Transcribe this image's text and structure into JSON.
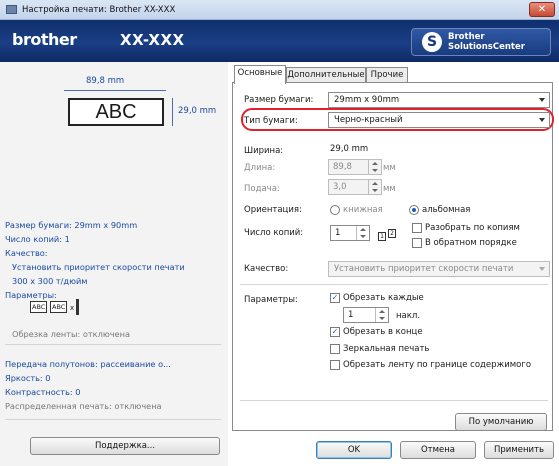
{
  "window": {
    "title": "Настройка печати: Brother XX-XXX",
    "close_glyph": "✕"
  },
  "brand": {
    "logo": "brother",
    "model": "XX-XXX",
    "solutions_line1": "Brother",
    "solutions_line2": "SolutionsCenter",
    "solutions_glyph": "S"
  },
  "preview": {
    "width_label": "89,8 mm",
    "height_label": "29,0 mm",
    "sample_text": "ABC"
  },
  "summary": {
    "paper_size": "Размер бумаги: 29mm x 90mm",
    "copies": "Число копий: 1",
    "quality_heading": "Качество:",
    "quality_value": "Установить приоритет скорости печати",
    "resolution": "300 x 300 т/дюйм",
    "params_heading": "Параметры:",
    "icon_text_1": "ABC",
    "icon_text_2": "ABC",
    "icon_mult": "x",
    "cut_tape": "Обрезка ленты: отключена",
    "halftone": "Передача полутонов: рассеивание о...",
    "brightness": "Яркость:  0",
    "contrast": "Контрастность:  0",
    "distributed": "Распределенная печать: отключена"
  },
  "buttons": {
    "support": "Поддержка...",
    "default": "По умолчанию",
    "ok": "OK",
    "cancel": "Отмена",
    "apply": "Применить"
  },
  "tabs": [
    "Основные",
    "Дополнительные",
    "Прочие"
  ],
  "basic": {
    "paper_size_label": "Размер бумаги:",
    "paper_size_value": "29mm x 90mm",
    "paper_type_label": "Тип бумаги:",
    "paper_type_value": "Черно-красный",
    "width_label": "Ширина:",
    "width_value": "29,0 mm",
    "length_label": "Длина:",
    "length_value": "89,8",
    "length_unit": "мм",
    "feed_label": "Подача:",
    "feed_value": "3,0",
    "feed_unit": "мм",
    "orientation_label": "Ориентация:",
    "orientation_portrait": "книжная",
    "orientation_landscape": "альбомная",
    "copies_label": "Число копий:",
    "copies_value": "1",
    "collate_label": "Разобрать по копиям",
    "reverse_label": "В обратном порядке",
    "collate_icon_1": "1",
    "collate_icon_2": "2",
    "quality_label": "Качество:",
    "quality_value": "Установить приоритет скорости печати",
    "options_label": "Параметры:",
    "cut_every_label": "Обрезать каждые",
    "cut_every_value": "1",
    "cut_every_unit": "накл.",
    "cut_at_end_label": "Обрезать в конце",
    "mirror_label": "Зеркальная печать",
    "trim_label": "Обрезать ленту по границе содержимого",
    "check_glyph": "✓"
  }
}
